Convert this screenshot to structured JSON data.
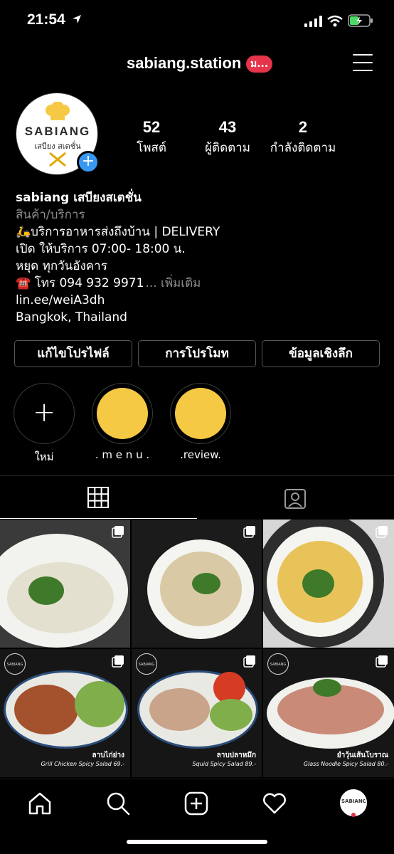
{
  "status": {
    "time": "21:54"
  },
  "header": {
    "username": "sabiang.station",
    "badge": "ม..."
  },
  "profile": {
    "avatar_brand": "SABIANG",
    "avatar_sub": "เสบียง สเตชั่น",
    "stats": [
      {
        "num": "52",
        "label": "โพสต์"
      },
      {
        "num": "43",
        "label": "ผู้ติดตาม"
      },
      {
        "num": "2",
        "label": "กำลังติดตาม"
      }
    ],
    "name": "sabiang เสบียงสเตชั่น",
    "category": "สินค้า/บริการ",
    "bio_lines": [
      "🛵บริการอาหารส่งถึงบ้าน | DELIVERY",
      "เปิด ให้บริการ 07:00- 18:00 น.",
      "หยุด ทุกวันอังคาร",
      "☎️ โทร 094 932 9971"
    ],
    "more": "... เพิ่มเติม",
    "link": "lin.ee/weiA3dh",
    "location": "Bangkok, Thailand"
  },
  "buttons": {
    "edit": "แก้ไขโปรไฟล์",
    "promo": "การโปรโมท",
    "insight": "ข้อมูลเชิงลึก"
  },
  "highlights": [
    {
      "label": "ใหม่"
    },
    {
      "label": ". m e n u ."
    },
    {
      "label": ".review."
    }
  ],
  "posts": [
    {
      "caption": "",
      "sub": ""
    },
    {
      "caption": "",
      "sub": ""
    },
    {
      "caption": "",
      "sub": ""
    },
    {
      "caption": "ลาบไก่ย่าง",
      "sub": "Grill Chicken Spicy Salad",
      "price": "69.-"
    },
    {
      "caption": "ลาบปลาหมึก",
      "sub": "Squid Spicy Salad",
      "price": "89.-"
    },
    {
      "caption": "ยำวุ้นเส้นโบราณ",
      "sub": "Glass Noodle Spicy Salad",
      "price": "80.-"
    }
  ],
  "colors": {
    "accent_blue": "#3897f0",
    "badge_red": "#e6344a",
    "highlight_yellow": "#f6c945"
  }
}
